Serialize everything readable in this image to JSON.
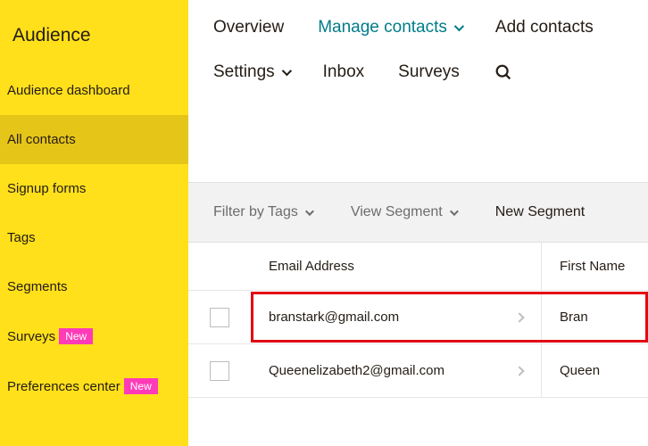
{
  "sidebar": {
    "title": "Audience",
    "items": [
      {
        "label": "Audience dashboard",
        "active": false,
        "badge": null
      },
      {
        "label": "All contacts",
        "active": true,
        "badge": null
      },
      {
        "label": "Signup forms",
        "active": false,
        "badge": null
      },
      {
        "label": "Tags",
        "active": false,
        "badge": null
      },
      {
        "label": "Segments",
        "active": false,
        "badge": null
      },
      {
        "label": "Surveys",
        "active": false,
        "badge": "New"
      },
      {
        "label": "Preferences center",
        "active": false,
        "badge": "New"
      }
    ]
  },
  "topnav": {
    "row1": [
      {
        "label": "Overview",
        "current": false,
        "dropdown": false
      },
      {
        "label": "Manage contacts",
        "current": true,
        "dropdown": true
      },
      {
        "label": "Add contacts",
        "current": false,
        "dropdown": false
      }
    ],
    "row2": [
      {
        "label": "Settings",
        "current": false,
        "dropdown": true
      },
      {
        "label": "Inbox",
        "current": false,
        "dropdown": false
      },
      {
        "label": "Surveys",
        "current": false,
        "dropdown": false
      }
    ]
  },
  "toolbar": {
    "filter_tags": "Filter by Tags",
    "view_segment": "View Segment",
    "new_segment": "New Segment"
  },
  "table": {
    "headers": {
      "email": "Email Address",
      "first_name": "First Name"
    },
    "rows": [
      {
        "email": "branstark@gmail.com",
        "first_name": "Bran",
        "highlighted": true
      },
      {
        "email": "Queenelizabeth2@gmail.com",
        "first_name": "Queen",
        "highlighted": false
      }
    ]
  }
}
